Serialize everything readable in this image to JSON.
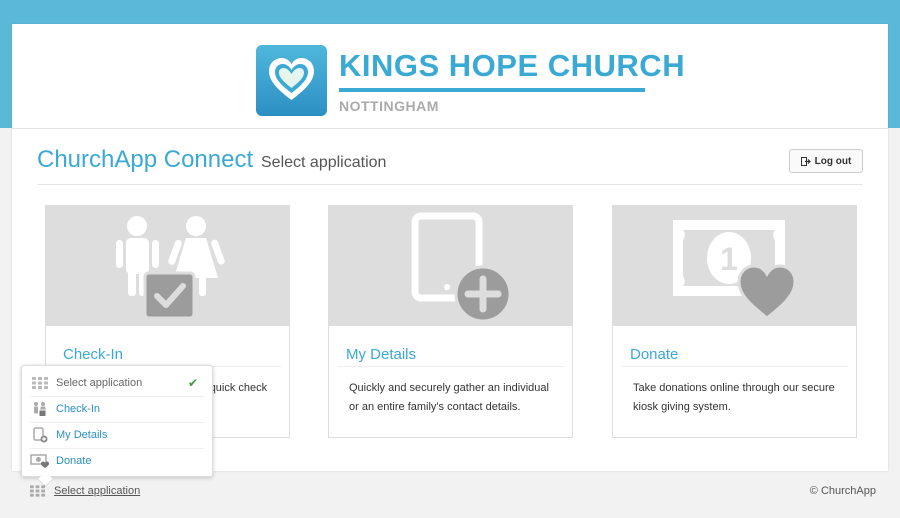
{
  "brand": {
    "name": "KINGS HOPE CHURCH",
    "city": "NOTTINGHAM",
    "accent": "#3aa9d3",
    "header_band": "#5bb9d8"
  },
  "page": {
    "app_title": "ChurchApp Connect",
    "subtitle": "Select application",
    "logout_label": "Log out",
    "logout_icon": "sign-out-icon"
  },
  "cards": [
    {
      "title": "Check-In",
      "desc": "Check in with ease using our quick check in",
      "icon": "family-check-icon"
    },
    {
      "title": "My Details",
      "desc": "Quickly and securely gather an individual or an entire family's contact details.",
      "icon": "tablet-plus-icon"
    },
    {
      "title": "Donate",
      "desc": "Take donations online through our secure kiosk giving system.",
      "icon": "banknote-heart-icon"
    }
  ],
  "popup": {
    "items": [
      {
        "label": "Select application",
        "icon": "grid-icon",
        "selected": true
      },
      {
        "label": "Check-In",
        "icon": "family-check-icon"
      },
      {
        "label": "My Details",
        "icon": "tablet-plus-icon"
      },
      {
        "label": "Donate",
        "icon": "banknote-heart-icon"
      }
    ]
  },
  "footer": {
    "link_label": "Select application",
    "copyright": "© ChurchApp"
  }
}
